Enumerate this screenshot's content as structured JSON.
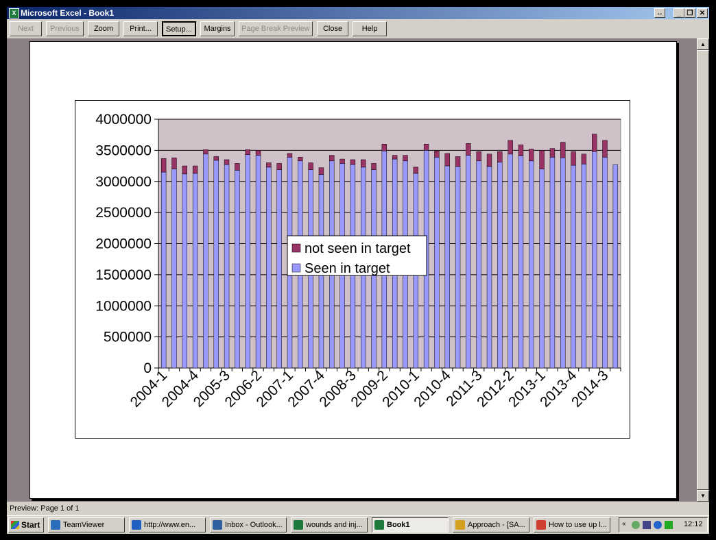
{
  "window": {
    "title": "Microsoft Excel - Book1"
  },
  "toolbar": {
    "buttons": [
      {
        "label": "Next",
        "enabled": false
      },
      {
        "label": "Previous",
        "enabled": false
      },
      {
        "label": "Zoom",
        "enabled": true
      },
      {
        "label": "Print...",
        "enabled": true
      },
      {
        "label": "Setup...",
        "enabled": true,
        "pressed": true
      },
      {
        "label": "Margins",
        "enabled": true
      },
      {
        "label": "Page Break Preview",
        "enabled": false
      },
      {
        "label": "Close",
        "enabled": true
      },
      {
        "label": "Help",
        "enabled": true
      }
    ]
  },
  "status": {
    "text": "Preview: Page 1 of 1"
  },
  "chart_data": {
    "type": "bar",
    "stacked": true,
    "ylim": [
      0,
      4000000
    ],
    "yticks": [
      "4000000",
      "3500000",
      "3000000",
      "2500000",
      "2000000",
      "1500000",
      "1000000",
      "500000",
      "0"
    ],
    "ytick_values": [
      4000000,
      3500000,
      3000000,
      2500000,
      2000000,
      1500000,
      1000000,
      500000,
      0
    ],
    "xtick_labels": [
      "2004-1",
      "2004-4",
      "2005-3",
      "2006-2",
      "2007-1",
      "2007-4",
      "2008-3",
      "2009-2",
      "2010-1",
      "2010-4",
      "2011-3",
      "2012-2",
      "2013-1",
      "2013-4",
      "2014-3"
    ],
    "xtick_every": 3,
    "legend": {
      "placement": "center"
    },
    "plot_area_color": "#d0c0c8",
    "series": [
      {
        "name": "not seen in target",
        "color": "#993366",
        "values": [
          220000,
          180000,
          130000,
          120000,
          70000,
          60000,
          80000,
          110000,
          80000,
          80000,
          70000,
          100000,
          60000,
          60000,
          110000,
          110000,
          90000,
          70000,
          80000,
          120000,
          100000,
          110000,
          60000,
          90000,
          100000,
          100000,
          100000,
          200000,
          160000,
          190000,
          150000,
          200000,
          170000,
          220000,
          180000,
          190000,
          300000,
          140000,
          250000,
          220000,
          160000,
          280000,
          270000
        ]
      },
      {
        "name": "Seen in target",
        "color": "#9999ff",
        "values": [
          3150000,
          3200000,
          3120000,
          3130000,
          3440000,
          3340000,
          3270000,
          3180000,
          3430000,
          3420000,
          3230000,
          3190000,
          3390000,
          3330000,
          3190000,
          3110000,
          3330000,
          3290000,
          3270000,
          3230000,
          3190000,
          3490000,
          3360000,
          3330000,
          3130000,
          3500000,
          3390000,
          3250000,
          3240000,
          3420000,
          3330000,
          3240000,
          3310000,
          3440000,
          3410000,
          3330000,
          3200000,
          3390000,
          3380000,
          3260000,
          3280000,
          3480000,
          3390000,
          3270000
        ]
      }
    ]
  },
  "taskbar": {
    "start_label": "Start",
    "tasks": [
      {
        "label": "TeamViewer",
        "icon": "teamviewer-icon",
        "color": "#2a6ebb"
      },
      {
        "label": "http://www.en...",
        "icon": "ie-icon",
        "color": "#2060c0"
      },
      {
        "label": "Inbox - Outlook...",
        "icon": "outlook-icon",
        "color": "#3060a0"
      },
      {
        "label": "wounds and inj...",
        "icon": "excel-icon",
        "color": "#1e7a3c"
      },
      {
        "label": "Book1",
        "icon": "excel-icon",
        "color": "#1e7a3c",
        "active": true
      },
      {
        "label": "Approach - [SA...",
        "icon": "approach-icon",
        "color": "#d4a020"
      },
      {
        "label": "How to use up l...",
        "icon": "chrome-icon",
        "color": "#d04030"
      }
    ],
    "clock": "12:12"
  }
}
